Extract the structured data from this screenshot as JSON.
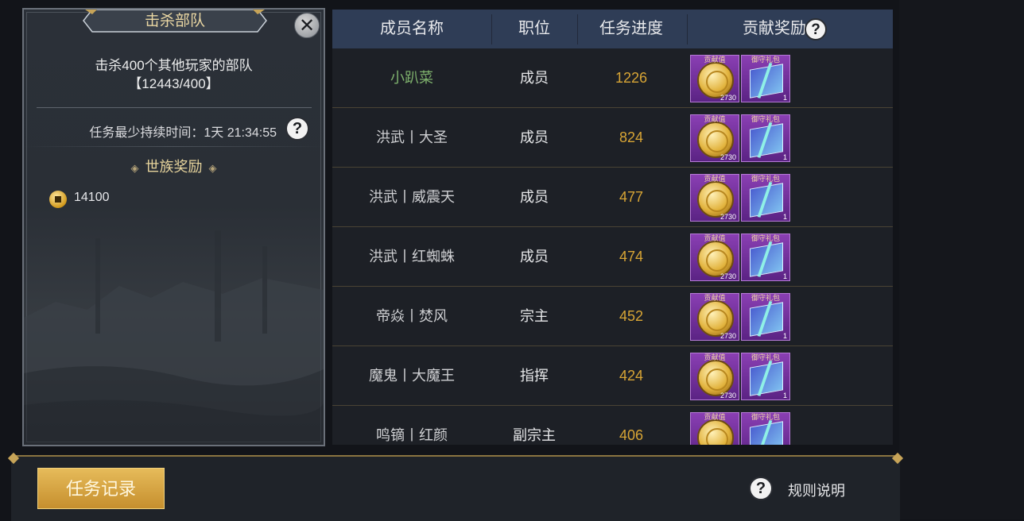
{
  "left_panel": {
    "title": "击杀部队",
    "close_glyph": "✕",
    "description": "击杀400个其他玩家的部队",
    "progress_text": "【12443/400】",
    "duration_text": "任务最少持续时间：1天 21:34:55",
    "help_glyph": "?",
    "reward_title": "世族奖励",
    "reward_deco_left": "◈",
    "reward_deco_right": "◈",
    "reward_icon": "coin-icon",
    "reward_value": "14100"
  },
  "table": {
    "headers": {
      "name": "成员名称",
      "role": "职位",
      "progress": "任务进度",
      "reward": "贡献奖励"
    },
    "reward_items": {
      "item1_label": "贡献值",
      "item1_qty": "2730",
      "item2_label": "御守礼包",
      "item2_qty": "1"
    },
    "rows": [
      {
        "name": "小趴菜",
        "role": "成员",
        "progress": "1226"
      },
      {
        "name": "洪武丨大圣",
        "role": "成员",
        "progress": "824"
      },
      {
        "name": "洪武丨威震天",
        "role": "成员",
        "progress": "477"
      },
      {
        "name": "洪武丨红蜘蛛",
        "role": "成员",
        "progress": "474"
      },
      {
        "name": "帝焱丨焚风",
        "role": "宗主",
        "progress": "452"
      },
      {
        "name": "魔鬼丨大魔王",
        "role": "指挥",
        "progress": "424"
      },
      {
        "name": "鸣镝丨红颜",
        "role": "副宗主",
        "progress": "406"
      }
    ]
  },
  "bottom_bar": {
    "record_button": "任务记录",
    "rules_label": "规则说明",
    "help_glyph": "?"
  },
  "colors": {
    "header_bg": "#2f3d56",
    "progress": "#d8a535",
    "highlight_name": "#7fb26d",
    "gold_button": "#d9a545"
  }
}
